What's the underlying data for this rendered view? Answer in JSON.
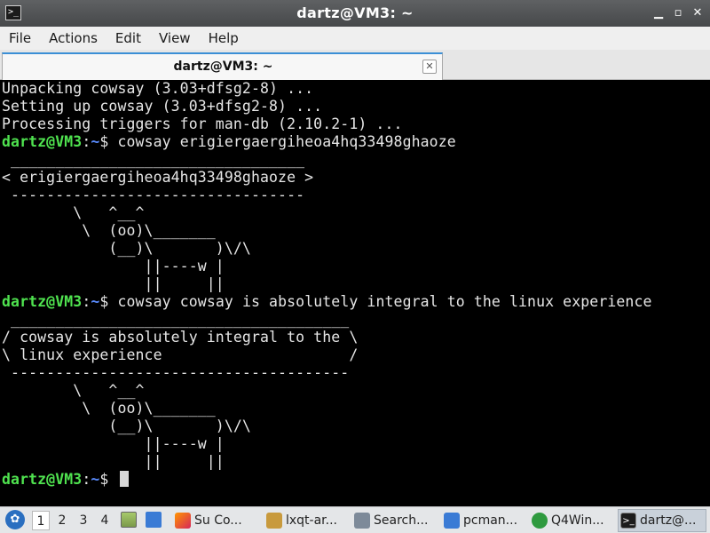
{
  "window": {
    "title": "dartz@VM3: ~",
    "app_icon_glyph": ">_"
  },
  "menu": [
    "File",
    "Actions",
    "Edit",
    "View",
    "Help"
  ],
  "tab": {
    "label": "dartz@VM3: ~",
    "close_glyph": "✕"
  },
  "terminal": {
    "prompt_user": "dartz@VM3",
    "prompt_sep": ":",
    "prompt_path": "~",
    "prompt_symbol": "$ ",
    "lines": [
      "Unpacking cowsay (3.03+dfsg2-8) ...",
      "Setting up cowsay (3.03+dfsg2-8) ...",
      "Processing triggers for man-db (2.10.2-1) ...",
      " cowsay erigiergaergiheoa4hq33498ghaoze",
      " _________________________________",
      "< erigiergaergiheoa4hq33498ghaoze >",
      " ---------------------------------",
      "        \\   ^__^",
      "         \\  (oo)\\_______",
      "            (__)\\       )\\/\\",
      "                ||----w |",
      "                ||     ||",
      " cowsay cowsay is absolutely integral to the linux experience",
      " ______________________________________",
      "/ cowsay is absolutely integral to the \\",
      "\\ linux experience                     /",
      " --------------------------------------",
      "        \\   ^__^",
      "         \\  (oo)\\_______",
      "            (__)\\       )\\/\\",
      "                ||----w |",
      "                ||     ||",
      " "
    ]
  },
  "taskbar": {
    "workspaces": [
      "1",
      "2",
      "3",
      "4"
    ],
    "tasks": [
      {
        "label": "Su Co...",
        "icon": "firefox-icon"
      },
      {
        "label": "lxqt-ar...",
        "icon": "archiver-icon"
      },
      {
        "label": "Search...",
        "icon": "search-app-icon"
      },
      {
        "label": "pcman...",
        "icon": "folder-icon"
      },
      {
        "label": "Q4Win...",
        "icon": "q4wine-icon"
      },
      {
        "label": "dartz@...",
        "icon": "terminal-icon"
      }
    ]
  },
  "colors": {
    "prompt_user": "#4fe24f",
    "prompt_path": "#5a8cff",
    "tab_accent": "#3b8fd6"
  }
}
